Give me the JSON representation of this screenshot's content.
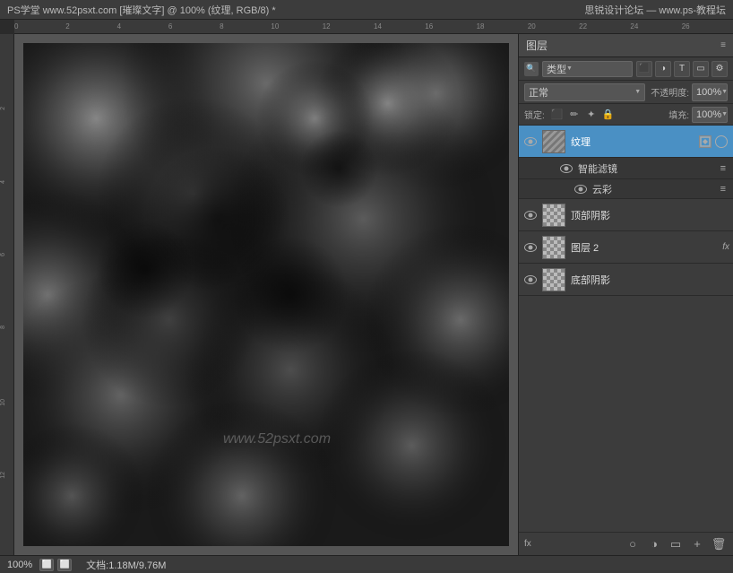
{
  "titlebar": {
    "left": "PS学堂 www.52psxt.com [璀璨文字] @ 100% (纹理, RGB/8) *",
    "right": "思锐设计论坛 — www.ps-教程坛"
  },
  "ruler": {
    "marks": [
      "0",
      "2",
      "4",
      "6",
      "8",
      "10",
      "12",
      "14",
      "16",
      "18",
      "20",
      "22",
      "24",
      "26"
    ]
  },
  "layers_panel": {
    "title": "图层",
    "filter_label": "类型",
    "blend_mode": "正常",
    "opacity_label": "不透明度:",
    "opacity_value": "100%",
    "lock_label": "锁定:",
    "fill_label": "填充:",
    "fill_value": "100%",
    "layers": [
      {
        "name": "纹理",
        "visible": true,
        "active": true,
        "has_smart": true,
        "smart_filters": [
          {
            "name": "智能滤镜",
            "visible": true
          },
          {
            "name": "云彩",
            "visible": true
          }
        ]
      },
      {
        "name": "顶部阴影",
        "visible": true,
        "active": false
      },
      {
        "name": "图层 2",
        "visible": true,
        "active": false,
        "fx": true
      },
      {
        "name": "底部阴影",
        "visible": true,
        "active": false
      }
    ],
    "bottom_icons": [
      "fx",
      "○",
      "▭",
      "☰",
      "🗑"
    ]
  },
  "statusbar": {
    "zoom": "100%",
    "doc_info": "文档:1.18M/9.76M"
  },
  "watermark": "www.52psxt.com"
}
